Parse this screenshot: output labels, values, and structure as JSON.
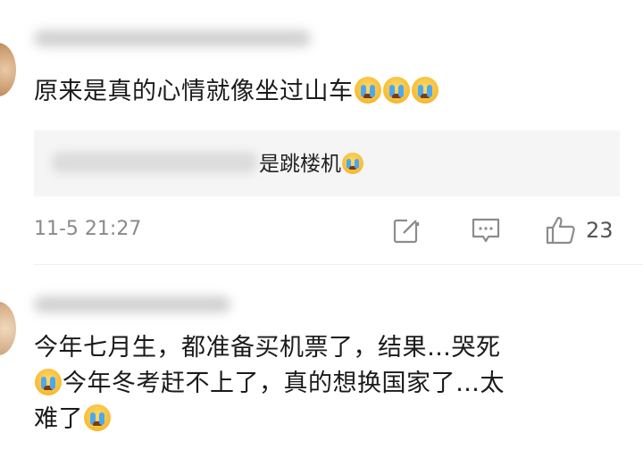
{
  "comments": [
    {
      "text": "原来是真的心情就像坐过山车",
      "emojis": [
        "crying-emoji",
        "crying-emoji",
        "crying-emoji"
      ],
      "quote": {
        "visible_text": "是跳楼机"
      },
      "timestamp": "11-5 21:27",
      "likes": "23"
    },
    {
      "line1": "今年七月生，都准备买机票了，结果…哭死",
      "line2": "今年冬考赶不上了，真的想换国家了…太",
      "line3": "难了"
    }
  ],
  "colors": {
    "background": "#ffffff",
    "text": "#1a1a1a",
    "muted": "#8a8a8a",
    "quote_bg": "#f5f5f5",
    "icon": "#8c8c8c"
  },
  "icons": [
    "share-icon",
    "reply-icon",
    "like-icon",
    "crying-emoji"
  ]
}
